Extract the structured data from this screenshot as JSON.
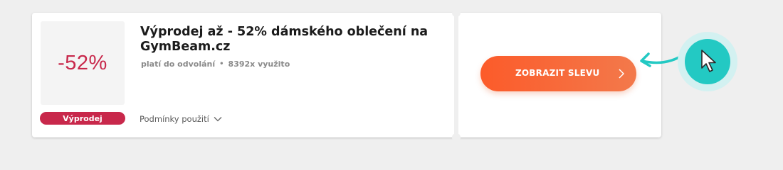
{
  "coupon": {
    "discount": "-52%",
    "badge": "Výprodej",
    "title": "Výprodej až - 52% dámského oblečení na GymBeam.cz",
    "validity": "platí do odvolání",
    "separator": "•",
    "usage": "8392x využito",
    "terms_label": "Podmínky použití",
    "cta_label": "ZOBRAZIT SLEVU"
  },
  "colors": {
    "background": "#efefef",
    "accent_red": "#c8284b",
    "button_gradient_start": "#fc5b2a",
    "button_gradient_end": "#f3794b",
    "cursor_teal": "#23c9c3"
  },
  "icons": {
    "terms_toggle": "chevron-down-icon",
    "cta": "chevron-right-icon",
    "hint_arrow": "curved-arrow-icon",
    "cursor": "mouse-pointer-icon"
  }
}
